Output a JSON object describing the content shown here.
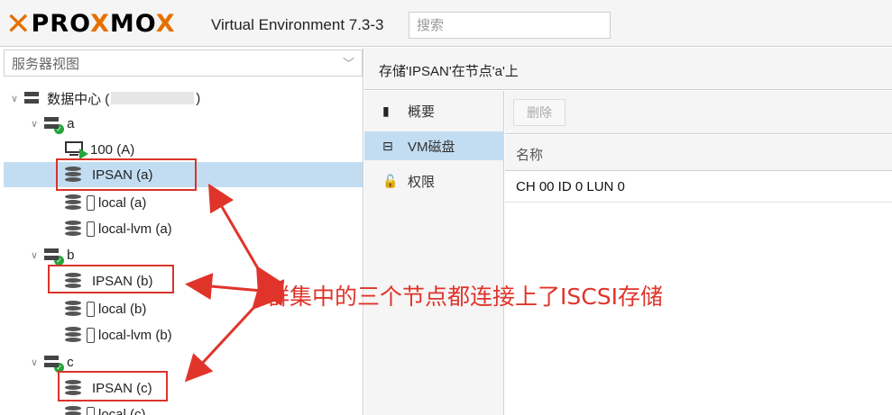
{
  "header": {
    "logo_word": "PROXMOX",
    "product_title": "Virtual Environment 7.3-3",
    "search_placeholder": "搜索"
  },
  "left_panel": {
    "view_selector": "服务器视图",
    "tree": [
      {
        "label": "数据中心 (",
        "suffix": ")",
        "kind": "datacenter"
      },
      {
        "label": "a",
        "kind": "node"
      },
      {
        "label": "100 (A)",
        "kind": "vm"
      },
      {
        "label": "IPSAN (a)",
        "kind": "storage",
        "selected": true,
        "highlighted": true
      },
      {
        "label": "local (a)",
        "kind": "storage-local"
      },
      {
        "label": "local-lvm (a)",
        "kind": "storage-local"
      },
      {
        "label": "b",
        "kind": "node"
      },
      {
        "label": "IPSAN (b)",
        "kind": "storage",
        "highlighted": true
      },
      {
        "label": "local (b)",
        "kind": "storage-local"
      },
      {
        "label": "local-lvm (b)",
        "kind": "storage-local"
      },
      {
        "label": "c",
        "kind": "node"
      },
      {
        "label": "IPSAN (c)",
        "kind": "storage",
        "highlighted": true
      },
      {
        "label": "local (c)",
        "kind": "storage-local"
      }
    ]
  },
  "right_panel": {
    "title": "存储'IPSAN'在节点'a'上",
    "nav": [
      {
        "label": "概要",
        "icon": "book-icon"
      },
      {
        "label": "VM磁盘",
        "icon": "disk-icon",
        "active": true
      },
      {
        "label": "权限",
        "icon": "unlock-icon"
      }
    ],
    "toolbar": {
      "delete_label": "删除"
    },
    "grid": {
      "column_header": "名称",
      "rows": [
        "CH 00 ID 0 LUN 0"
      ]
    }
  },
  "annotation": {
    "text": "群集中的三个节点都连接上了ISCSI存储",
    "color": "#e0342b"
  },
  "colors": {
    "brand_orange": "#e57000",
    "selection_blue": "#c2ddf2",
    "status_green": "#25a53b"
  }
}
